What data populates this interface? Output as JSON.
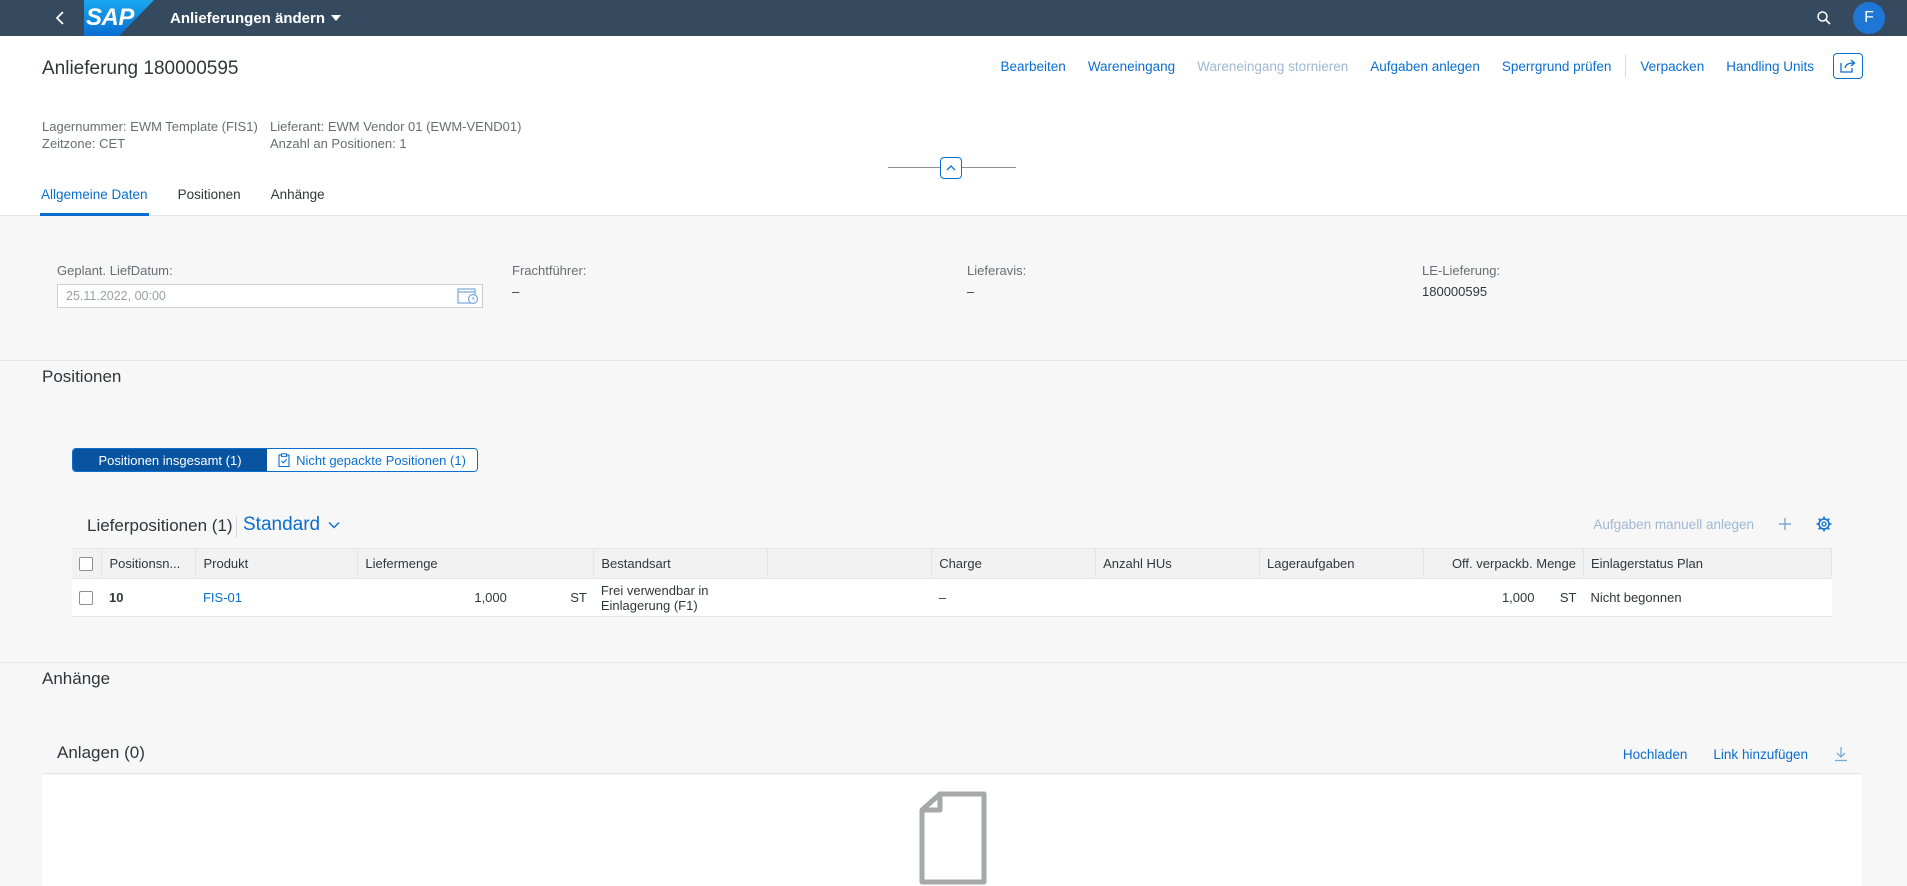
{
  "shell": {
    "app_title": "Anlieferungen ändern",
    "logo_text": "SAP",
    "avatar_initial": "F"
  },
  "header": {
    "title": "Anlieferung 180000595",
    "actions": [
      {
        "label": "Bearbeiten",
        "enabled": true
      },
      {
        "label": "Wareneingang",
        "enabled": true
      },
      {
        "label": "Wareneingang stornieren",
        "enabled": false
      },
      {
        "label": "Aufgaben anlegen",
        "enabled": true
      },
      {
        "label": "Sperrgrund prüfen",
        "enabled": true
      },
      {
        "label": "Verpacken",
        "enabled": true
      },
      {
        "label": "Handling Units",
        "enabled": true
      }
    ],
    "attributes": {
      "lagernummer": "Lagernummer: EWM Template (FIS1)",
      "zeitzone": "Zeitzone: CET",
      "lieferant": "Lieferant: EWM Vendor 01 (EWM-VEND01)",
      "anzahl_positionen": "Anzahl an Positionen: 1"
    },
    "tabs": [
      {
        "label": "Allgemeine Daten",
        "active": true
      },
      {
        "label": "Positionen",
        "active": false
      },
      {
        "label": "Anhänge",
        "active": false
      }
    ]
  },
  "general": {
    "geplant_label": "Geplant. LiefDatum:",
    "geplant_value": "25.11.2022, 00:00",
    "frachtfuehrer_label": "Frachtführer:",
    "frachtfuehrer_value": "–",
    "lieferavis_label": "Lieferavis:",
    "lieferavis_value": "–",
    "le_lieferung_label": "LE-Lieferung:",
    "le_lieferung_value": "180000595"
  },
  "positionen": {
    "section_title": "Positionen",
    "segments": [
      "Positionen insgesamt (1)",
      "Nicht gepackte Positionen (1)"
    ],
    "table_title": "Lieferpositionen (1)",
    "variant": "Standard",
    "toolbar_action": "Aufgaben manuell anlegen",
    "columns": [
      "Positionsn...",
      "Produkt",
      "Liefermenge",
      "Bestandsart",
      "",
      "Charge",
      "Anzahl HUs",
      "Lageraufgaben",
      "Off. verpackb. Menge",
      "Einlagerstatus Plan"
    ],
    "rows": [
      {
        "position": "10",
        "produkt": "FIS-01",
        "liefermenge": "1,000",
        "liefermenge_unit": "ST",
        "bestandsart": "Frei verwendbar in Einlagerung (F1)",
        "charge": "–",
        "anzahl_hus": "",
        "lageraufgaben": "",
        "off_menge": "1,000",
        "off_unit": "ST",
        "einlagerstatus": "Nicht begonnen"
      }
    ]
  },
  "anhaenge": {
    "section_title": "Anhänge",
    "card_title": "Anlagen (0)",
    "actions": [
      "Hochladen",
      "Link hinzufügen"
    ]
  },
  "colors": {
    "shell": "#354a5f",
    "accent": "#0a6ed1",
    "segment_active": "#0854a0"
  }
}
